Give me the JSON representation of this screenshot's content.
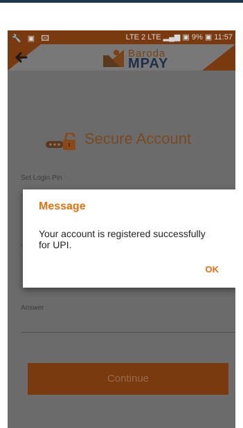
{
  "status_bar": {
    "left_icons": "🔧 ▣ 🖾",
    "right_text": "LTE 2 LTE ▂▄▆ ▣ 9% ▣ 11:57",
    "battery": "9%",
    "time": "11:57"
  },
  "header": {
    "back_icon": "arrow-left",
    "logo": {
      "line1": "Baroda",
      "line2": "MPAY"
    }
  },
  "page": {
    "lock_icon": "key-lock",
    "title": "Secure Account",
    "fields": [
      {
        "label": "Set Login Pin"
      },
      {
        "label": "Answer"
      }
    ],
    "continue_label": "Continue"
  },
  "dialog": {
    "title": "Message",
    "message": "Your account is registered successfully for UPI.",
    "ok_label": "OK"
  },
  "colors": {
    "accent": "#e8710d",
    "brand_brown": "#7a3a10",
    "overlay_gray": "#6b6b6b",
    "navy": "#1c3550"
  }
}
